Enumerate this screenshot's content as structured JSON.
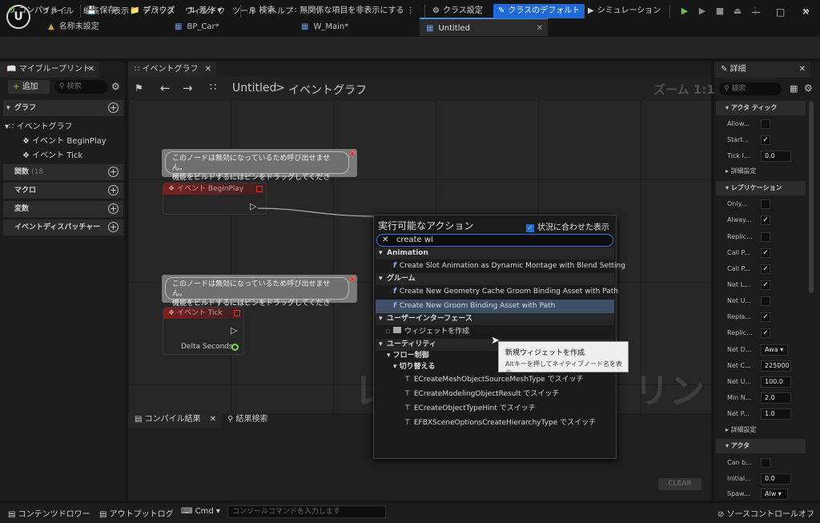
{
  "menu": {
    "logo": "U",
    "items": [
      "ファイル",
      "編集",
      "表示",
      "デバッグ",
      "ウィンドウ",
      "ツール",
      "ヘルプ"
    ]
  },
  "doc_tabs": [
    {
      "label": "名称未設定",
      "icon": "level-icon"
    },
    {
      "label": "BP_Car*",
      "icon": "blueprint-icon"
    },
    {
      "label": "W_Main*",
      "icon": "widget-icon"
    },
    {
      "label": "Untitled",
      "icon": "blueprint-icon",
      "active": true
    }
  ],
  "toolbar": {
    "compile": "コンパイル",
    "save": "保存",
    "browse": "ブラウズ",
    "diff": "差分",
    "search": "検索",
    "hide_unrelated": "無関係な項目を非表示にする",
    "class_settings": "クラス設定",
    "class_defaults": "クラスのデフォルト",
    "simulation": "シミュレーション"
  },
  "my_blueprint": {
    "tab": "マイブループリント",
    "add": "追加",
    "search_placeholder": "検索",
    "sections": {
      "graph": "グラフ",
      "functions": "関数",
      "functions_count": "(18",
      "macros": "マクロ",
      "variables": "変数",
      "dispatchers": "イベントディスパッチャー"
    },
    "tree": {
      "event_graph": "イベントグラフ",
      "begin_play": "イベント BeginPlay",
      "tick": "イベント Tick"
    }
  },
  "graph": {
    "tab": "イベントグラフ",
    "breadcrumb_root": "Untitled",
    "breadcrumb_sep": ">",
    "breadcrumb_leaf": "イベントグラフ",
    "zoom": "ズーム 1:1",
    "watermark_left": "レ",
    "watermark_right": "リント",
    "comment_line1": "このノードは無効になっているため呼び出せません。",
    "comment_line2": "機能をビルドするにはピンをドラッグしてください。",
    "node_begin_play": "イベント BeginPlay",
    "node_tick": "イベント Tick",
    "delta_seconds": "Delta Seconds"
  },
  "bottom": {
    "compile_results_tab": "コンパイル結果",
    "find_results_tab": "結果検索",
    "clear": "CLEAR"
  },
  "details": {
    "tab": "詳細",
    "search_placeholder": "検索",
    "actor_tick": "アクタ ティック",
    "allow": "Allow...",
    "start": "Start...",
    "tick_interval": "Tick I...",
    "tick_interval_value": "0.0",
    "advanced1": "詳細設定",
    "replication": "レプリケーション",
    "only": "Only...",
    "always": "Alway...",
    "replic1": "Replic...",
    "callp1": "Call P...",
    "callp2": "Call P...",
    "netl": "Net L...",
    "netu1": "Net U...",
    "repla": "Repla...",
    "replic2": "Replic...",
    "netd": "Net D...",
    "netd_value": "Awa",
    "netc": "Net C...",
    "netc_value": "225000",
    "netu2": "Net U...",
    "netu2_value": "100.0",
    "minn": "Min N...",
    "minn_value": "2.0",
    "netp": "Net P...",
    "netp_value": "1.0",
    "advanced2": "詳細設定",
    "actor": "アクタ",
    "canb": "Can b...",
    "initial": "Initial...",
    "initial_value": "0.0",
    "spawn": "Spaw...",
    "spawn_value": "Alw"
  },
  "action_menu": {
    "title": "実行可能なアクション",
    "context": "状況に合わせた表示",
    "search_value": "create wi",
    "cat_animation": "Animation",
    "item_anim": "Create Slot Animation as Dynamic Montage with Blend Setting",
    "cat_groom": "グルーム",
    "item_groom1": "Create New Geometry Cache Groom Binding Asset with Path",
    "item_groom2": "Create New Groom Binding Asset with Path",
    "cat_ui": "ユーザーインターフェース",
    "item_widget": "ウィジェットを作成",
    "cat_utility": "ユーティリティ",
    "cat_flow": "フロー制御",
    "cat_switch": "切り替える",
    "switch1": "ECreateMeshObjectSourceMeshType でスイッチ",
    "switch2": "ECreateModelingObjectResult でスイッチ",
    "switch3": "ECreateObjectTypeHint でスイッチ",
    "switch4": "EFBXSceneOptionsCreateHierarchyType でスイッチ"
  },
  "tooltip": {
    "title": "新規ウィジェットを作成",
    "hint": "Altキーを押してネイティブノード名を表示"
  },
  "statusbar": {
    "content_drawer": "コンテンツドロワー",
    "output_log": "アウトプットログ",
    "cmd": "Cmd",
    "console_placeholder": "コンソールコマンドを入力します",
    "source_control": "ソースコントロールオフ"
  }
}
